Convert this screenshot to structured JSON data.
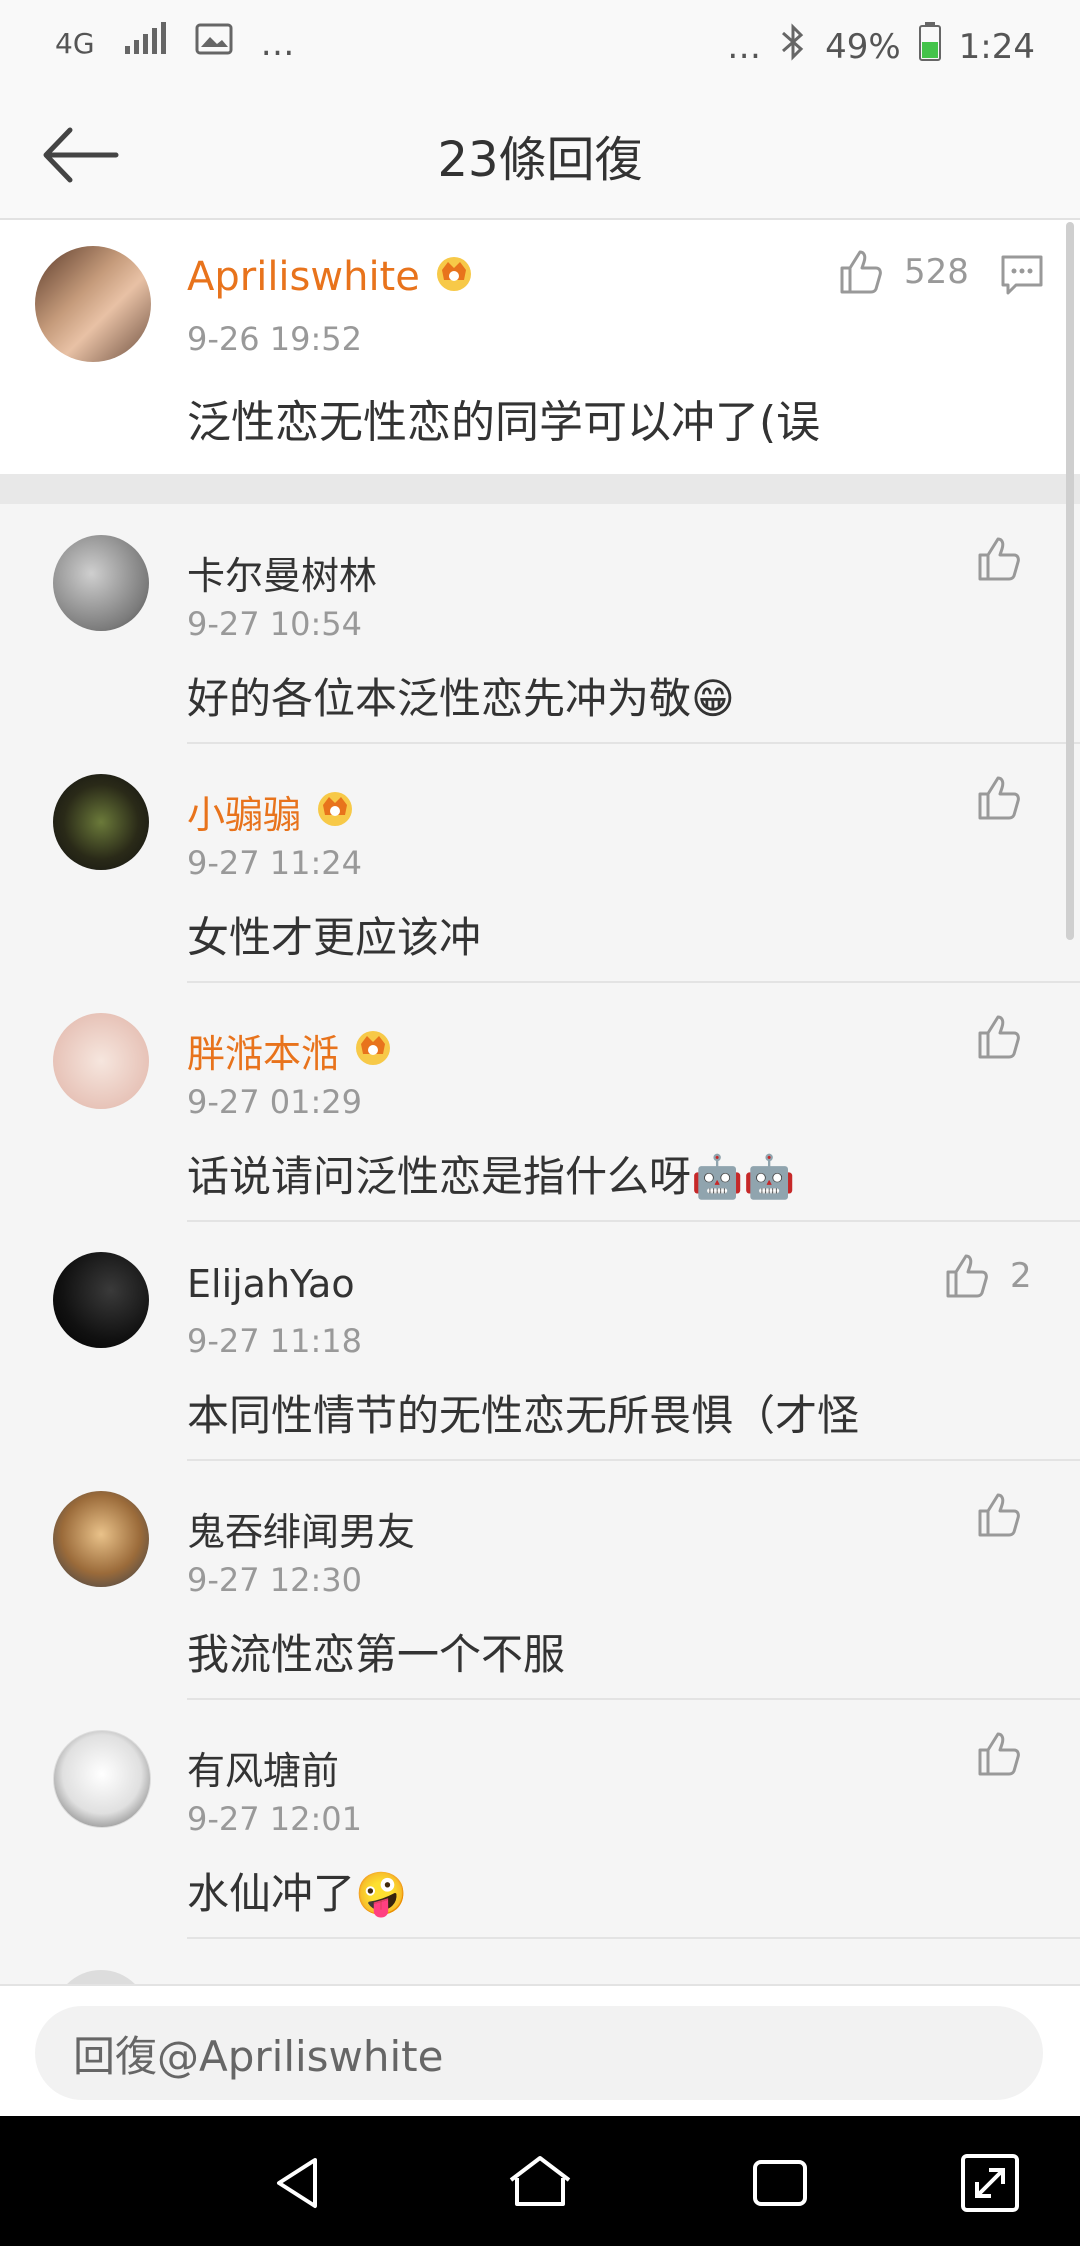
{
  "status_bar": {
    "network": "4G",
    "extra": "…",
    "right_extra": "…",
    "battery": "49%",
    "time": "1:24"
  },
  "nav": {
    "title": "23條回復"
  },
  "main_comment": {
    "username": "Apriliswhite",
    "time": "9-26 19:52",
    "text": "泛性恋无性恋的同学可以冲了(误",
    "likes": "528"
  },
  "replies": [
    {
      "username": "卡尔曼树林",
      "vip": false,
      "time": "9-27 10:54",
      "text": "好的各位本泛性恋先冲为敬😁",
      "likes": ""
    },
    {
      "username": "小骟骟",
      "vip": true,
      "time": "9-27 11:24",
      "text": "女性才更应该冲",
      "likes": ""
    },
    {
      "username": "胖湉本湉",
      "vip": true,
      "time": "9-27 01:29",
      "text": "话说请问泛性恋是指什么呀🤖🤖",
      "likes": ""
    },
    {
      "username": "ElijahYao",
      "vip": false,
      "time": "9-27 11:18",
      "text": "本同性情节的无性恋无所畏惧（才怪",
      "likes": "2"
    },
    {
      "username": "鬼吞绯闻男友",
      "vip": false,
      "time": "9-27 12:30",
      "text": "我流性恋第一个不服",
      "likes": ""
    },
    {
      "username": "有风塘前",
      "vip": false,
      "time": "9-27 12:01",
      "text": "水仙冲了🤪",
      "likes": ""
    }
  ],
  "input": {
    "placeholder": "回復@Apriliswhite"
  },
  "colors": {
    "vip_name": "#e8731c",
    "accent_bg": "#f5f5f5"
  }
}
